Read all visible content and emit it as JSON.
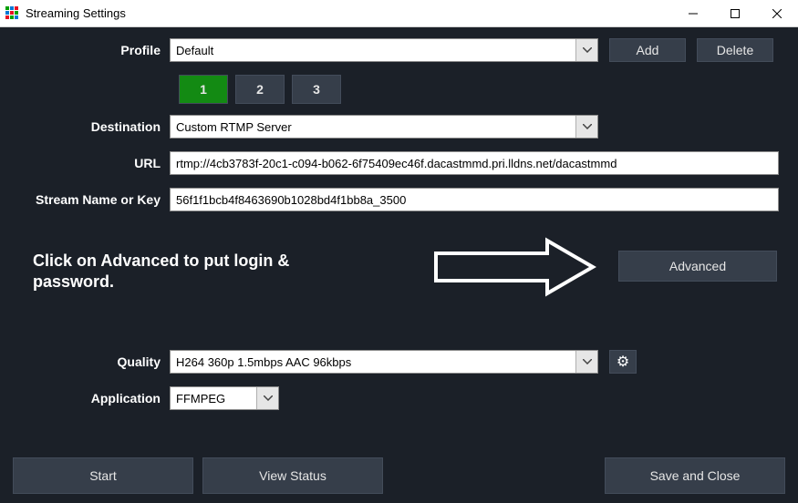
{
  "window": {
    "title": "Streaming Settings",
    "icon_colors": [
      "#00a000",
      "#0078d4",
      "#e81123",
      "#00a000",
      "#0078d4",
      "#e81123",
      "#0078d4",
      "#e81123",
      "#00a000"
    ]
  },
  "profile": {
    "label": "Profile",
    "value": "Default",
    "add": "Add",
    "delete": "Delete"
  },
  "tabs": {
    "t1": "1",
    "t2": "2",
    "t3": "3"
  },
  "dest": {
    "label": "Destination",
    "value": "Custom RTMP Server"
  },
  "url": {
    "label": "URL",
    "value": "rtmp://4cb3783f-20c1-c094-b062-6f75409ec46f.dacastmmd.pri.lldns.net/dacastmmd"
  },
  "streamkey": {
    "label": "Stream Name or Key",
    "value": "56f1f1bcb4f8463690b1028bd4f1bb8a_3500"
  },
  "annotation": {
    "text": "Click on Advanced to put login & password."
  },
  "advanced": {
    "label": "Advanced"
  },
  "quality": {
    "label": "Quality",
    "value": "H264 360p 1.5mbps AAC 96kbps"
  },
  "application": {
    "label": "Application",
    "value": "FFMPEG"
  },
  "bottom": {
    "start": "Start",
    "view_status": "View Status",
    "save_close": "Save and Close"
  }
}
